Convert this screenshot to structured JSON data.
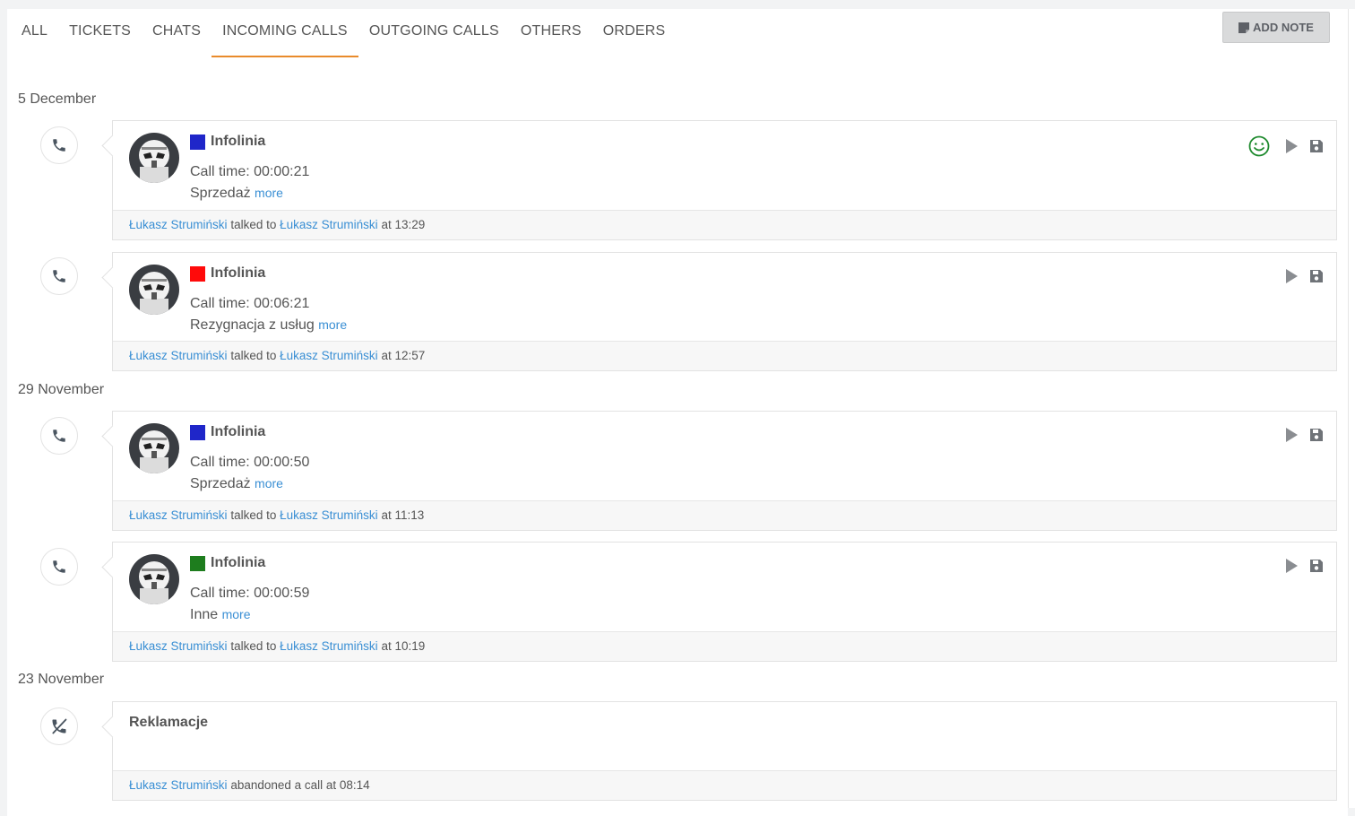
{
  "tabs": [
    {
      "label": "ALL"
    },
    {
      "label": "TICKETS"
    },
    {
      "label": "CHATS"
    },
    {
      "label": "INCOMING CALLS"
    },
    {
      "label": "OUTGOING CALLS"
    },
    {
      "label": "OTHERS"
    },
    {
      "label": "ORDERS"
    }
  ],
  "active_tab": "INCOMING CALLS",
  "add_note": {
    "label": "ADD NOTE",
    "icon": "note-icon"
  },
  "groups": [
    {
      "date": "5 December"
    },
    {
      "date": "29 November"
    },
    {
      "date": "23 November"
    }
  ],
  "calls": [
    {
      "title": "Infolinia",
      "swatch_color": "#1f26c9",
      "call_time": "Call time: 00:00:21",
      "reason": "Sprzedaż",
      "more": "more",
      "agent": "Łukasz Strumiński",
      "verb": "talked to",
      "customer": "Łukasz Strumiński",
      "at_text": "at 13:29",
      "smiley": true
    },
    {
      "title": "Infolinia",
      "swatch_color": "#ff0a0a",
      "call_time": "Call time: 00:06:21",
      "reason": "Rezygnacja z usług",
      "more": "more",
      "agent": "Łukasz Strumiński",
      "verb": "talked to",
      "customer": "Łukasz Strumiński",
      "at_text": "at 12:57",
      "smiley": false
    },
    {
      "title": "Infolinia",
      "swatch_color": "#1f26c9",
      "call_time": "Call time: 00:00:50",
      "reason": "Sprzedaż",
      "more": "more",
      "agent": "Łukasz Strumiński",
      "verb": "talked to",
      "customer": "Łukasz Strumiński",
      "at_text": "at 11:13",
      "smiley": false
    },
    {
      "title": "Infolinia",
      "swatch_color": "#1e7d1e",
      "call_time": "Call time: 00:00:59",
      "reason": "Inne",
      "more": "more",
      "agent": "Łukasz Strumiński",
      "verb": "talked to",
      "customer": "Łukasz Strumiński",
      "at_text": "at 10:19",
      "smiley": false
    }
  ],
  "abandoned": {
    "title": "Reklamacje",
    "agent": "Łukasz Strumiński",
    "text": "abandoned a call at 08:14"
  },
  "colors": {
    "accent_tab_underline": "#e98b2b",
    "link": "#3a8fd4",
    "smiley": "#1e8a2e"
  }
}
